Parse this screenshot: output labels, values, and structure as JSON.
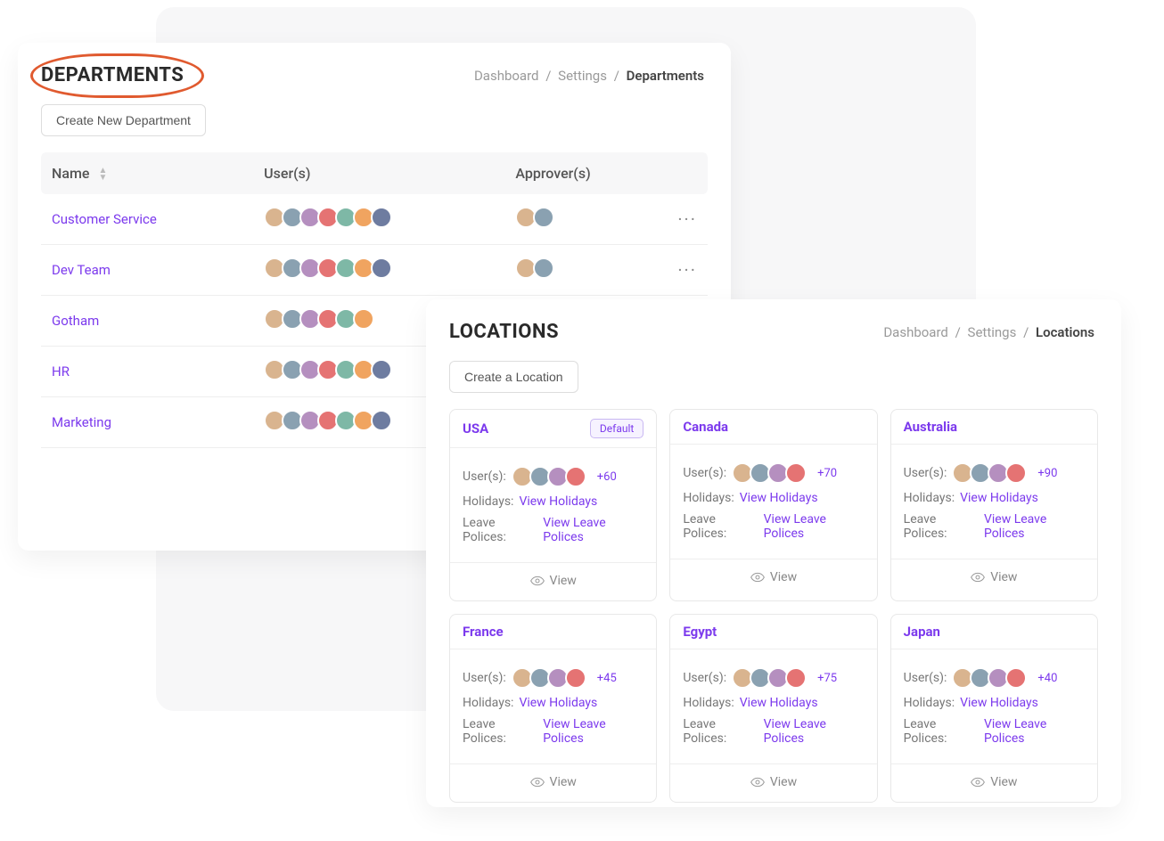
{
  "departments": {
    "title": "DEPARTMENTS",
    "breadcrumb": {
      "a": "Dashboard",
      "b": "Settings",
      "c": "Departments"
    },
    "create_btn": "Create New Department",
    "columns": {
      "name": "Name",
      "users": "User(s)",
      "approvers": "Approver(s)"
    },
    "rows": [
      {
        "name": "Customer Service",
        "users": 7,
        "approvers": 2
      },
      {
        "name": "Dev Team",
        "users": 7,
        "approvers": 2
      },
      {
        "name": "Gotham",
        "users": 6,
        "approvers": 0
      },
      {
        "name": "HR",
        "users": 7,
        "approvers": 0
      },
      {
        "name": "Marketing",
        "users": 7,
        "approvers": 0
      }
    ]
  },
  "locations": {
    "title": "LOCATIONS",
    "breadcrumb": {
      "a": "Dashboard",
      "b": "Settings",
      "c": "Locations"
    },
    "create_btn": "Create a Location",
    "labels": {
      "users": "User(s):",
      "holidays": "Holidays:",
      "policies": "Leave Polices:",
      "view_holidays": "View Holidays",
      "view_policies": "View Leave Polices",
      "view": "View",
      "default": "Default"
    },
    "cards": [
      {
        "name": "USA",
        "default": true,
        "extra": "+60"
      },
      {
        "name": "Canada",
        "default": false,
        "extra": "+70"
      },
      {
        "name": "Australia",
        "default": false,
        "extra": "+90"
      },
      {
        "name": "France",
        "default": false,
        "extra": "+45"
      },
      {
        "name": "Egypt",
        "default": false,
        "extra": "+75"
      },
      {
        "name": "Japan",
        "default": false,
        "extra": "+40"
      }
    ]
  }
}
